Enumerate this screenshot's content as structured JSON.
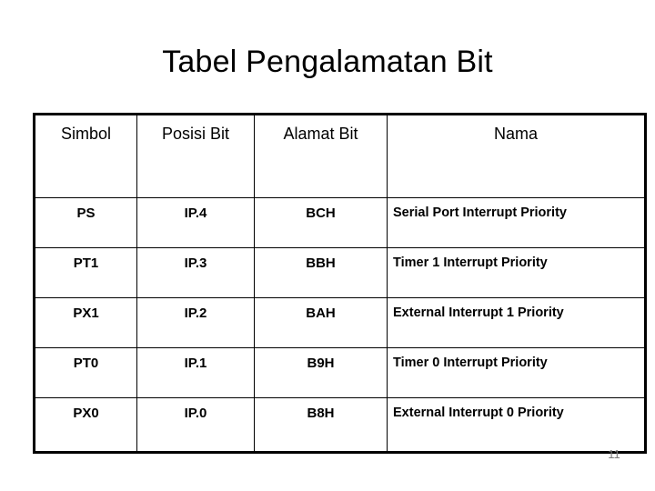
{
  "slide": {
    "title": "Tabel Pengalamatan Bit",
    "page_number": "11"
  },
  "table": {
    "headers": [
      "Simbol",
      "Posisi Bit",
      "Alamat Bit",
      "Nama"
    ],
    "rows": [
      {
        "simbol": "PS",
        "posisi_bit": "IP.4",
        "alamat_bit": "BCH",
        "nama": "Serial Port Interrupt Priority"
      },
      {
        "simbol": "PT1",
        "posisi_bit": "IP.3",
        "alamat_bit": "BBH",
        "nama": "Timer 1  Interrupt Priority"
      },
      {
        "simbol": "PX1",
        "posisi_bit": "IP.2",
        "alamat_bit": "BAH",
        "nama": "External Interrupt 1  Priority"
      },
      {
        "simbol": "PT0",
        "posisi_bit": "IP.1",
        "alamat_bit": "B9H",
        "nama": "Timer 0 Interrupt Priority"
      },
      {
        "simbol": "PX0",
        "posisi_bit": "IP.0",
        "alamat_bit": "B8H",
        "nama": "External Interrupt 0  Priority"
      }
    ]
  },
  "colors": {
    "background": "#ffffff",
    "text": "#000000",
    "border": "#000000",
    "page_number": "#7b7b7b"
  }
}
